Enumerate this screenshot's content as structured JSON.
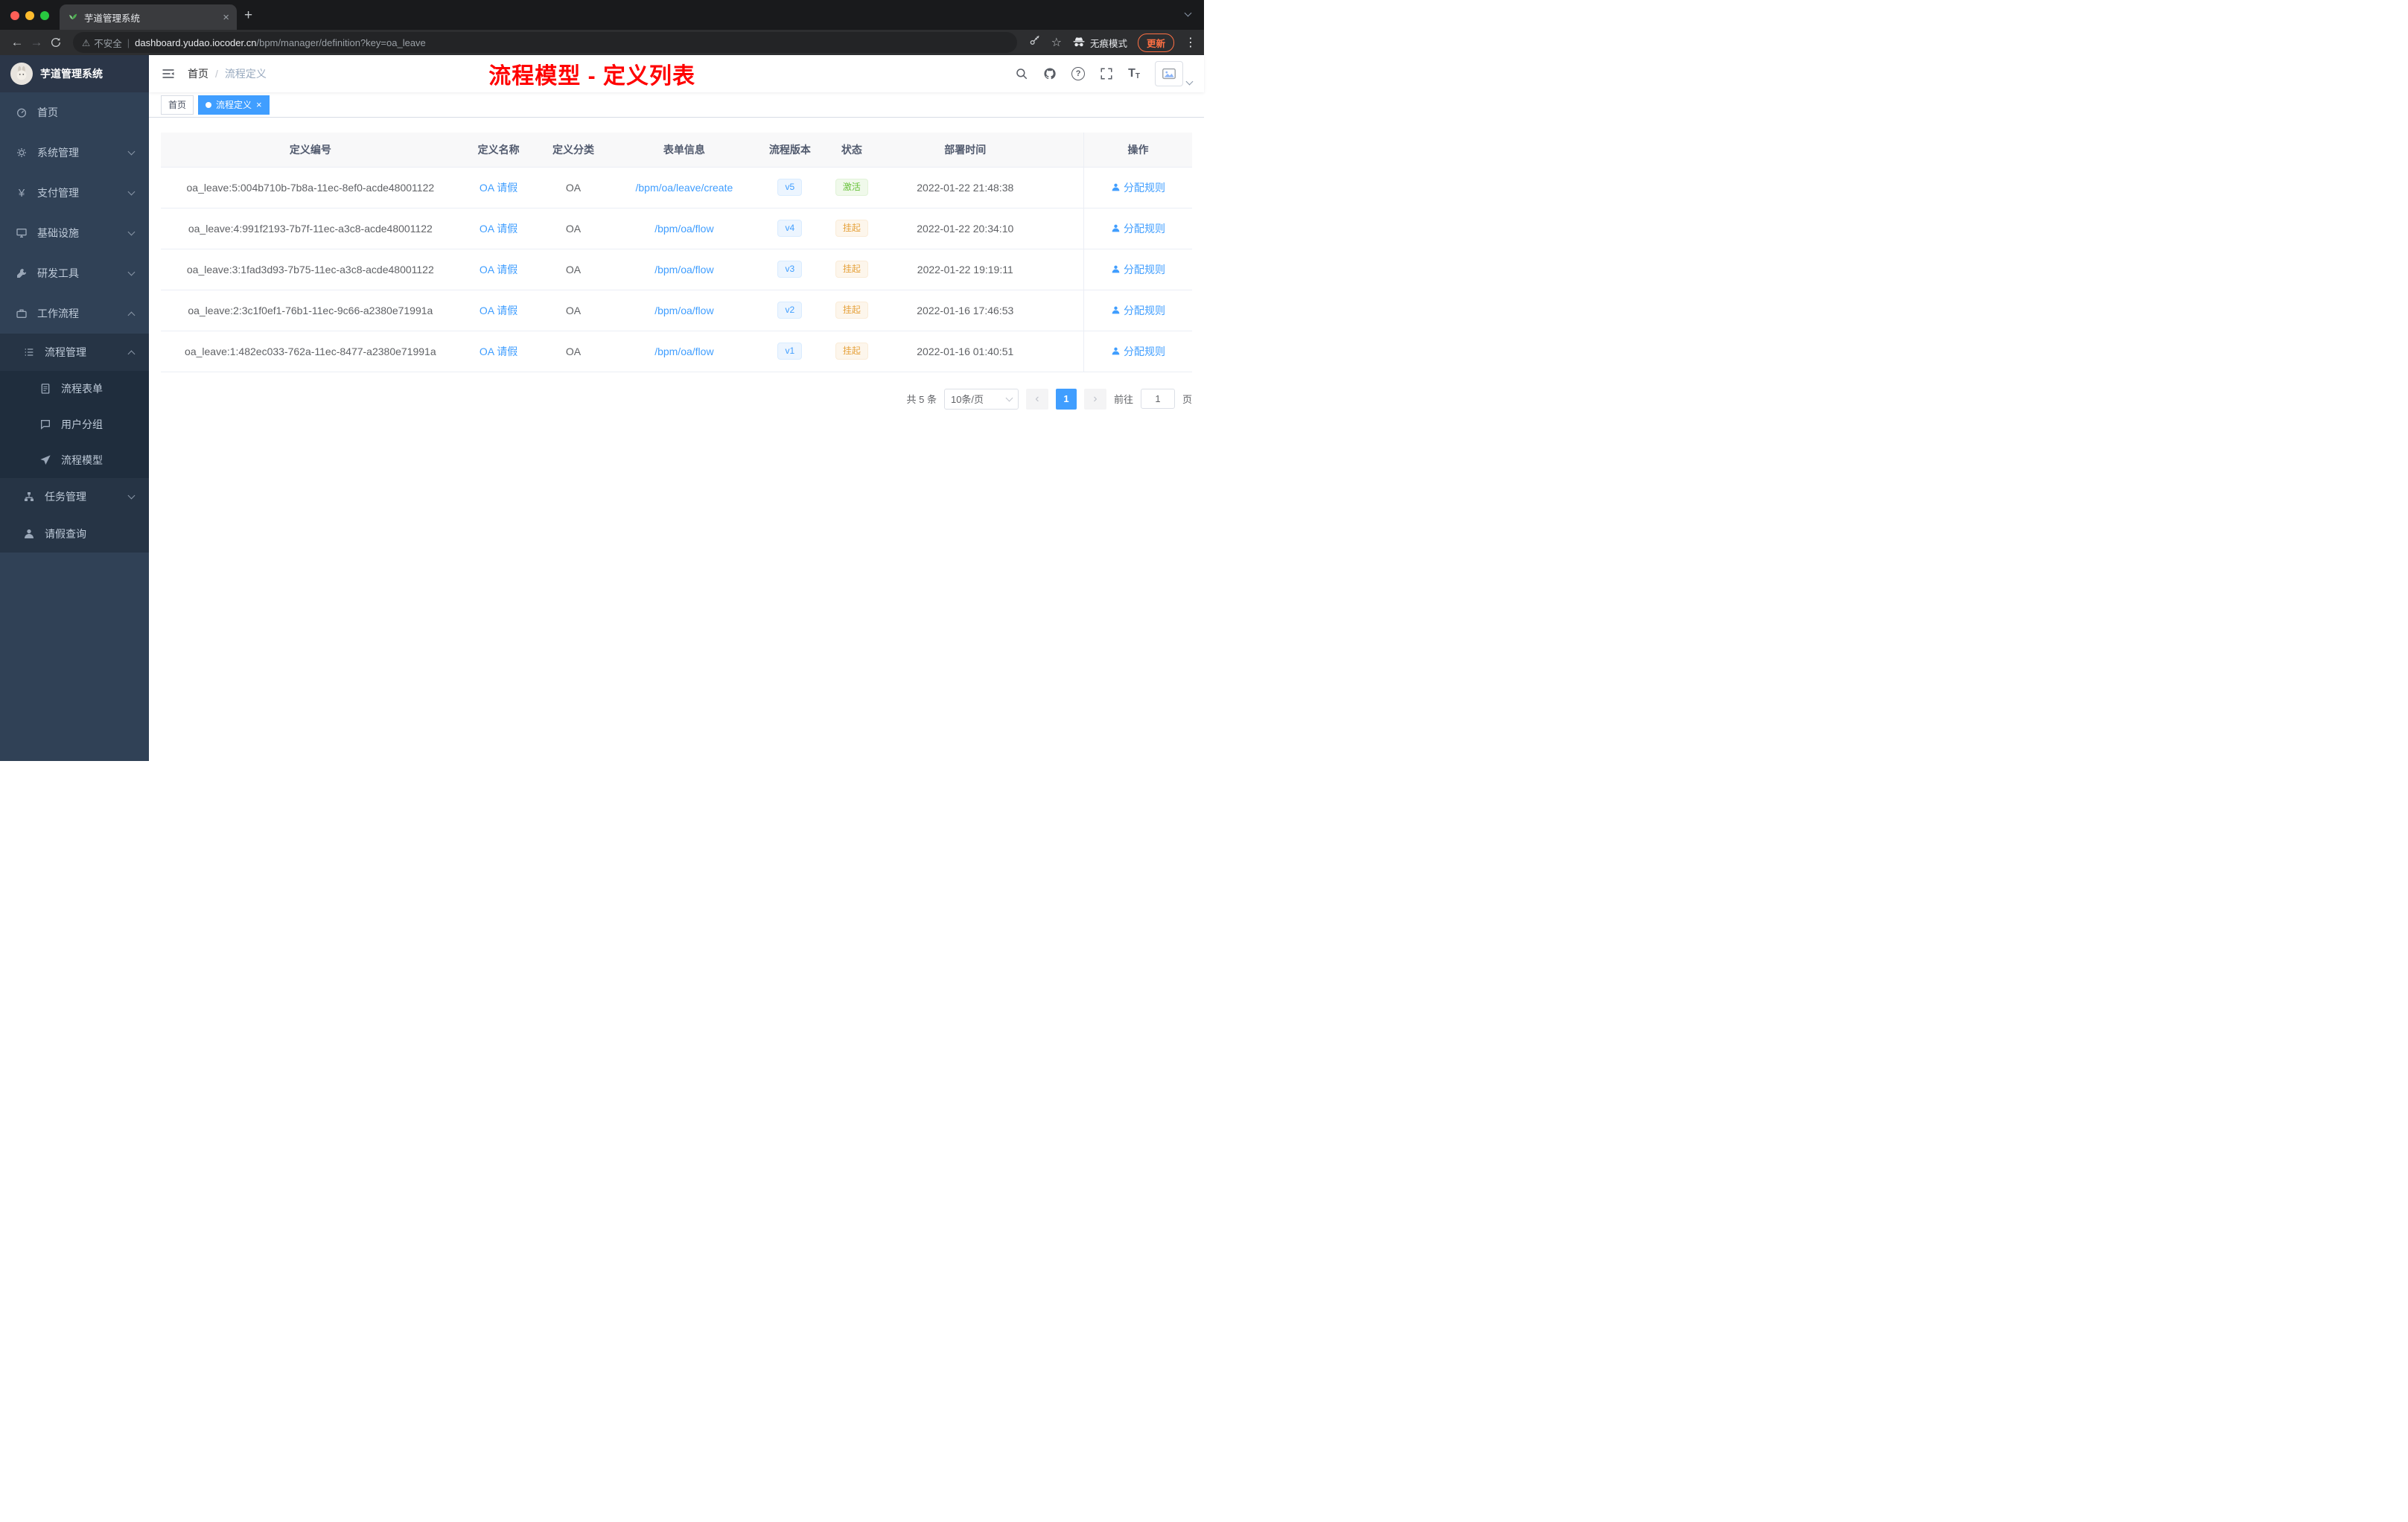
{
  "browser": {
    "tab_title": "芋道管理系统",
    "security_label": "不安全",
    "url_domain": "dashboard.yudao.iocoder.cn",
    "url_path": "/bpm/manager/definition?key=oa_leave",
    "incognito_label": "无痕模式",
    "update_label": "更新"
  },
  "icons": {
    "close": "×",
    "plus": "+",
    "back": "←",
    "forward": "→",
    "star": "☆",
    "warning": "⚠",
    "more": "⋮",
    "divider": "|",
    "prev": "‹",
    "next": "›",
    "question": "?",
    "yen": "¥",
    "text_large": "T",
    "text_small": "T",
    "breadcrumb_sep": "/"
  },
  "sidebar": {
    "logo_title": "芋道管理系统",
    "items": [
      {
        "label": "首页"
      },
      {
        "label": "系统管理"
      },
      {
        "label": "支付管理"
      },
      {
        "label": "基础设施"
      },
      {
        "label": "研发工具"
      },
      {
        "label": "工作流程"
      },
      {
        "label": "流程管理"
      },
      {
        "label": "流程表单"
      },
      {
        "label": "用户分组"
      },
      {
        "label": "流程模型"
      },
      {
        "label": "任务管理"
      },
      {
        "label": "请假查询"
      }
    ]
  },
  "header": {
    "breadcrumb_home": "首页",
    "breadcrumb_current": "流程定义",
    "annotation": "流程模型 - 定义列表"
  },
  "tags": {
    "home": "首页",
    "active": "流程定义"
  },
  "table": {
    "columns": [
      "定义编号",
      "定义名称",
      "定义分类",
      "表单信息",
      "流程版本",
      "状态",
      "部署时间",
      "操作"
    ],
    "rows": [
      {
        "id": "oa_leave:5:004b710b-7b8a-11ec-8ef0-acde48001122",
        "name": "OA 请假",
        "category": "OA",
        "form": "/bpm/oa/leave/create",
        "version": "v5",
        "status": "激活",
        "time": "2022-01-22 21:48:38",
        "action": "分配规则"
      },
      {
        "id": "oa_leave:4:991f2193-7b7f-11ec-a3c8-acde48001122",
        "name": "OA 请假",
        "category": "OA",
        "form": "/bpm/oa/flow",
        "version": "v4",
        "status": "挂起",
        "time": "2022-01-22 20:34:10",
        "action": "分配规则"
      },
      {
        "id": "oa_leave:3:1fad3d93-7b75-11ec-a3c8-acde48001122",
        "name": "OA 请假",
        "category": "OA",
        "form": "/bpm/oa/flow",
        "version": "v3",
        "status": "挂起",
        "time": "2022-01-22 19:19:11",
        "action": "分配规则"
      },
      {
        "id": "oa_leave:2:3c1f0ef1-76b1-11ec-9c66-a2380e71991a",
        "name": "OA 请假",
        "category": "OA",
        "form": "/bpm/oa/flow",
        "version": "v2",
        "status": "挂起",
        "time": "2022-01-16 17:46:53",
        "action": "分配规则"
      },
      {
        "id": "oa_leave:1:482ec033-762a-11ec-8477-a2380e71991a",
        "name": "OA 请假",
        "category": "OA",
        "form": "/bpm/oa/flow",
        "version": "v1",
        "status": "挂起",
        "time": "2022-01-16 01:40:51",
        "action": "分配规则"
      }
    ]
  },
  "pagination": {
    "total": "共 5 条",
    "page_size": "10条/页",
    "current_page": "1",
    "goto_label": "前往",
    "goto_value": "1",
    "unit_label": "页"
  },
  "colors": {
    "accent": "#409eff",
    "annotation_red": "#ff0000",
    "success": "#67c23a",
    "warning": "#e6a23c",
    "sidebar_bg": "#304156"
  }
}
